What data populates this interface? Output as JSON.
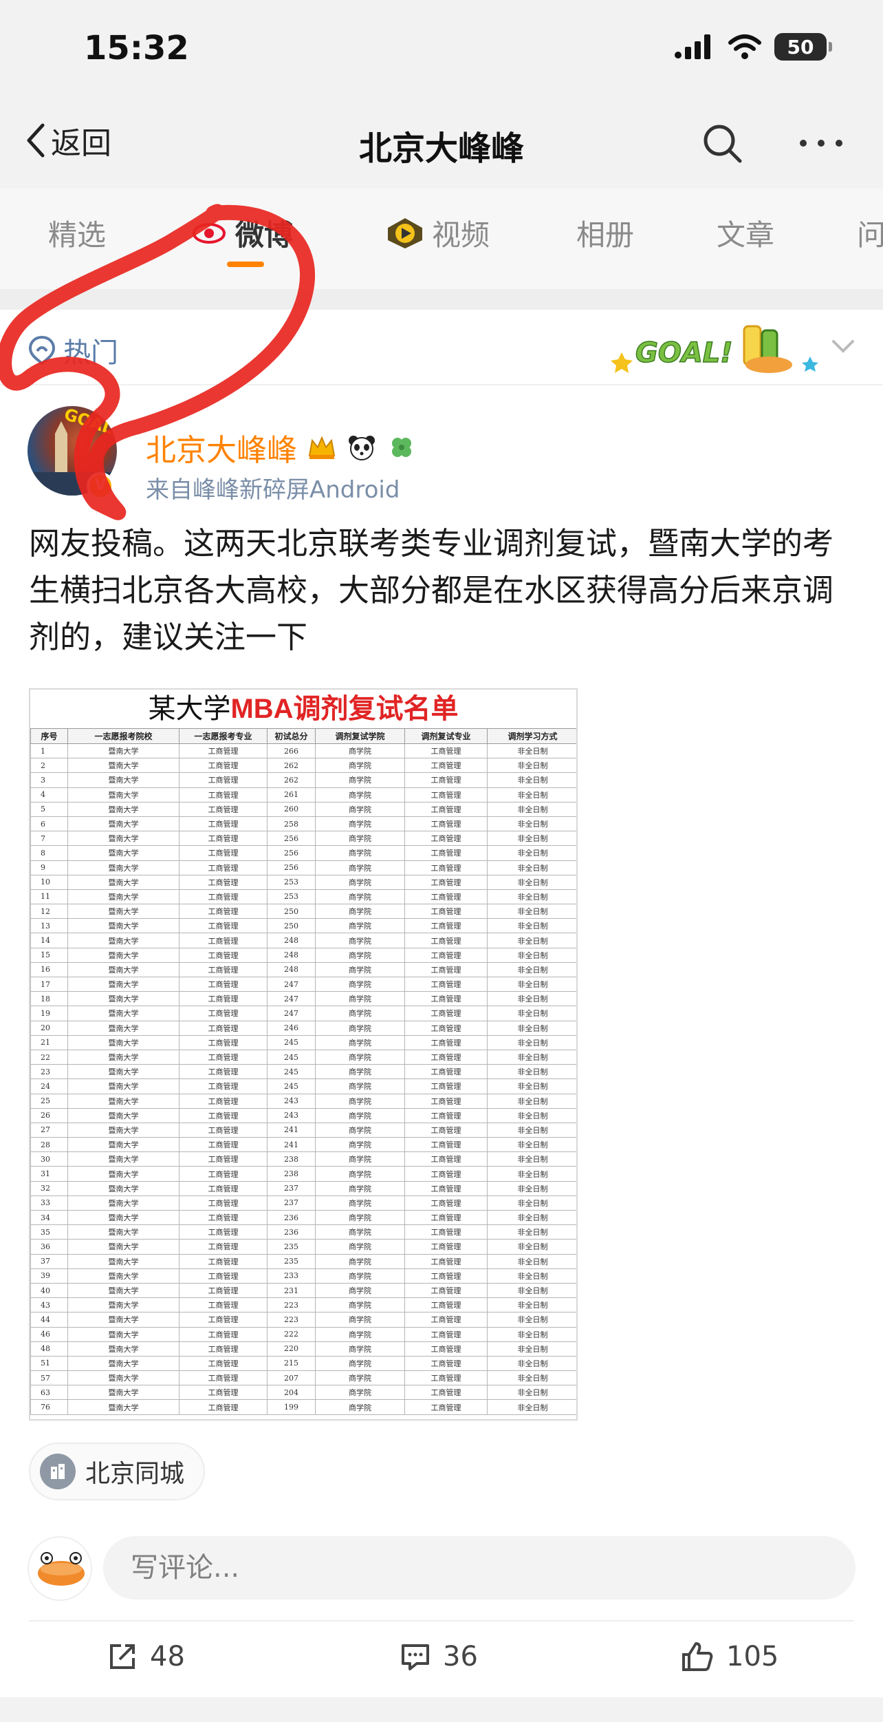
{
  "status_bar": {
    "time": "15:32",
    "battery": "50"
  },
  "nav": {
    "back_label": "返回",
    "title": "北京大峰峰"
  },
  "tabs": [
    {
      "label": "精选"
    },
    {
      "label": "微博"
    },
    {
      "label": "视频"
    },
    {
      "label": "相册"
    },
    {
      "label": "文章"
    },
    {
      "label": "问"
    }
  ],
  "filter": {
    "label": "热门",
    "badge_text": "GOAL!"
  },
  "post": {
    "author": "北京大峰峰",
    "source": "来自峰峰新碎屏Android",
    "text": "网友投稿。这两天北京联考类专业调剂复试，暨南大学的考生横扫北京各大高校，大部分都是在水区获得高分后来京调剂的，建议关注一下",
    "location_tag": "北京同城"
  },
  "image_table": {
    "title_prefix": "某大学",
    "title_highlight": "MBA调剂复试名单",
    "headers": [
      "序号",
      "一志愿报考院校",
      "一志愿报考专业",
      "初试总分",
      "调剂复试学院",
      "调剂复试专业",
      "调剂学习方式"
    ],
    "school": "暨南大学",
    "major": "工商管理",
    "college": "商学院",
    "mode": "非全日制",
    "rows": [
      [
        "1",
        "266"
      ],
      [
        "2",
        "262"
      ],
      [
        "3",
        "262"
      ],
      [
        "4",
        "261"
      ],
      [
        "5",
        "260"
      ],
      [
        "6",
        "258"
      ],
      [
        "7",
        "256"
      ],
      [
        "8",
        "256"
      ],
      [
        "9",
        "256"
      ],
      [
        "10",
        "253"
      ],
      [
        "11",
        "253"
      ],
      [
        "12",
        "250"
      ],
      [
        "13",
        "250"
      ],
      [
        "14",
        "248"
      ],
      [
        "15",
        "248"
      ],
      [
        "16",
        "248"
      ],
      [
        "17",
        "247"
      ],
      [
        "18",
        "247"
      ],
      [
        "19",
        "247"
      ],
      [
        "20",
        "246"
      ],
      [
        "21",
        "245"
      ],
      [
        "22",
        "245"
      ],
      [
        "23",
        "245"
      ],
      [
        "24",
        "245"
      ],
      [
        "25",
        "243"
      ],
      [
        "26",
        "243"
      ],
      [
        "27",
        "241"
      ],
      [
        "28",
        "241"
      ],
      [
        "30",
        "238"
      ],
      [
        "31",
        "238"
      ],
      [
        "32",
        "237"
      ],
      [
        "33",
        "237"
      ],
      [
        "34",
        "236"
      ],
      [
        "35",
        "236"
      ],
      [
        "36",
        "235"
      ],
      [
        "37",
        "235"
      ],
      [
        "39",
        "233"
      ],
      [
        "40",
        "231"
      ],
      [
        "43",
        "223"
      ],
      [
        "44",
        "223"
      ],
      [
        "46",
        "222"
      ],
      [
        "48",
        "220"
      ],
      [
        "51",
        "215"
      ],
      [
        "57",
        "207"
      ],
      [
        "63",
        "204"
      ],
      [
        "76",
        "199"
      ]
    ]
  },
  "comment": {
    "placeholder": "写评论..."
  },
  "actions": {
    "repost": "48",
    "comments": "36",
    "likes": "105"
  },
  "colors": {
    "accent": "#ff8200",
    "link": "#5b7ca8",
    "annotation": "#e8261f",
    "title_red": "#e12424"
  }
}
